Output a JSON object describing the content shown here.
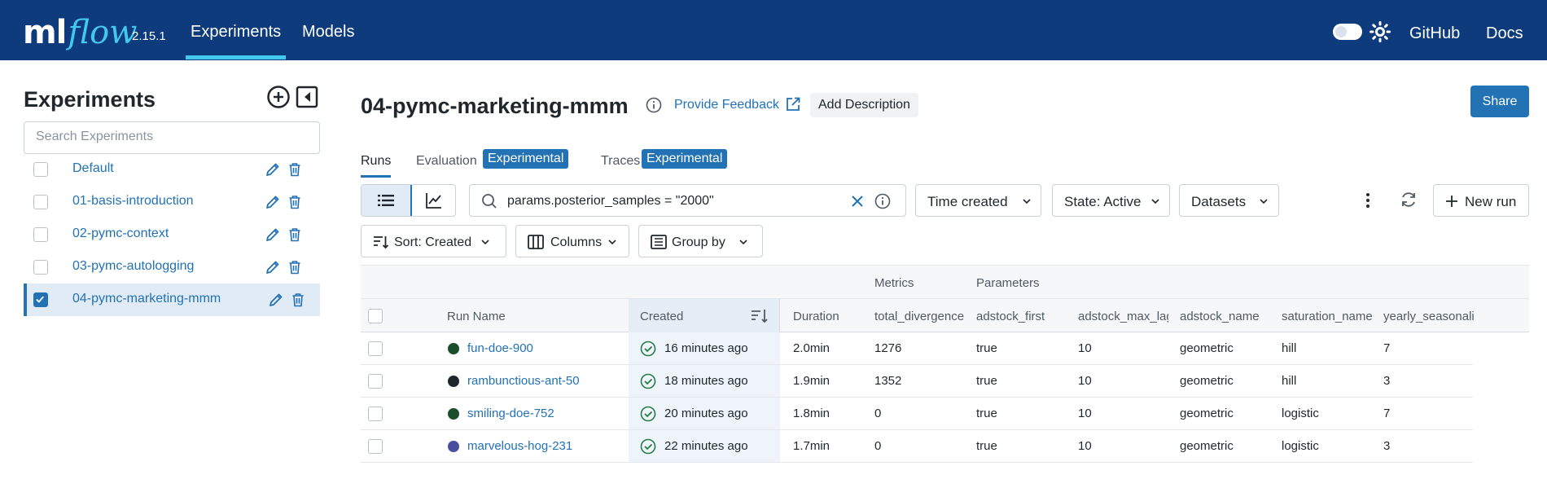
{
  "app": {
    "logo_ml": "ml",
    "logo_flow": "flow",
    "version": "2.15.1",
    "nav": [
      "Experiments",
      "Models"
    ],
    "links": [
      "GitHub",
      "Docs"
    ]
  },
  "sidebar": {
    "title": "Experiments",
    "search_placeholder": "Search Experiments",
    "items": [
      {
        "label": "Default",
        "selected": false
      },
      {
        "label": "01-basis-introduction",
        "selected": false
      },
      {
        "label": "02-pymc-context",
        "selected": false
      },
      {
        "label": "03-pymc-autologging",
        "selected": false
      },
      {
        "label": "04-pymc-marketing-mmm",
        "selected": true
      }
    ]
  },
  "header": {
    "title": "04-pymc-marketing-mmm",
    "feedback": "Provide Feedback",
    "add_description": "Add Description",
    "share": "Share"
  },
  "tabs": {
    "runs": "Runs",
    "evaluation": "Evaluation",
    "evaluation_badge": "Experimental",
    "traces": "Traces",
    "traces_badge": "Experimental"
  },
  "toolbar": {
    "filter": "params.posterior_samples = \"2000\"",
    "time_created": "Time created",
    "state": "State: Active",
    "datasets": "Datasets",
    "new_run": "New run",
    "sort": "Sort: Created",
    "columns": "Columns",
    "group_by": "Group by"
  },
  "table": {
    "groups": {
      "metrics": "Metrics",
      "parameters": "Parameters"
    },
    "columns": [
      "Run Name",
      "Created",
      "Duration",
      "total_divergence",
      "adstock_first",
      "adstock_max_lag",
      "adstock_name",
      "saturation_name",
      "yearly_seasonality"
    ],
    "rows": [
      {
        "name": "fun-doe-900",
        "color": "#1b4d2b",
        "created": "16 minutes ago",
        "duration": "2.0min",
        "total_divergence": "1276",
        "adstock_first": "true",
        "adstock_max_lag": "10",
        "adstock_name": "geometric",
        "saturation_name": "hill",
        "yearly_seasonality": "7"
      },
      {
        "name": "rambunctious-ant-50",
        "color": "#1f272d",
        "created": "18 minutes ago",
        "duration": "1.9min",
        "total_divergence": "1352",
        "adstock_first": "true",
        "adstock_max_lag": "10",
        "adstock_name": "geometric",
        "saturation_name": "hill",
        "yearly_seasonality": "3"
      },
      {
        "name": "smiling-doe-752",
        "color": "#1b4d2b",
        "created": "20 minutes ago",
        "duration": "1.8min",
        "total_divergence": "0",
        "adstock_first": "true",
        "adstock_max_lag": "10",
        "adstock_name": "geometric",
        "saturation_name": "logistic",
        "yearly_seasonality": "7"
      },
      {
        "name": "marvelous-hog-231",
        "color": "#4a4e9e",
        "created": "22 minutes ago",
        "duration": "1.7min",
        "total_divergence": "0",
        "adstock_first": "true",
        "adstock_max_lag": "10",
        "adstock_name": "geometric",
        "saturation_name": "logistic",
        "yearly_seasonality": "3"
      }
    ]
  },
  "colors": {
    "header_bg": "#0e3b7c",
    "accent": "#2272b4",
    "logo_flow": "#43c9ed",
    "success": "#277c43"
  }
}
